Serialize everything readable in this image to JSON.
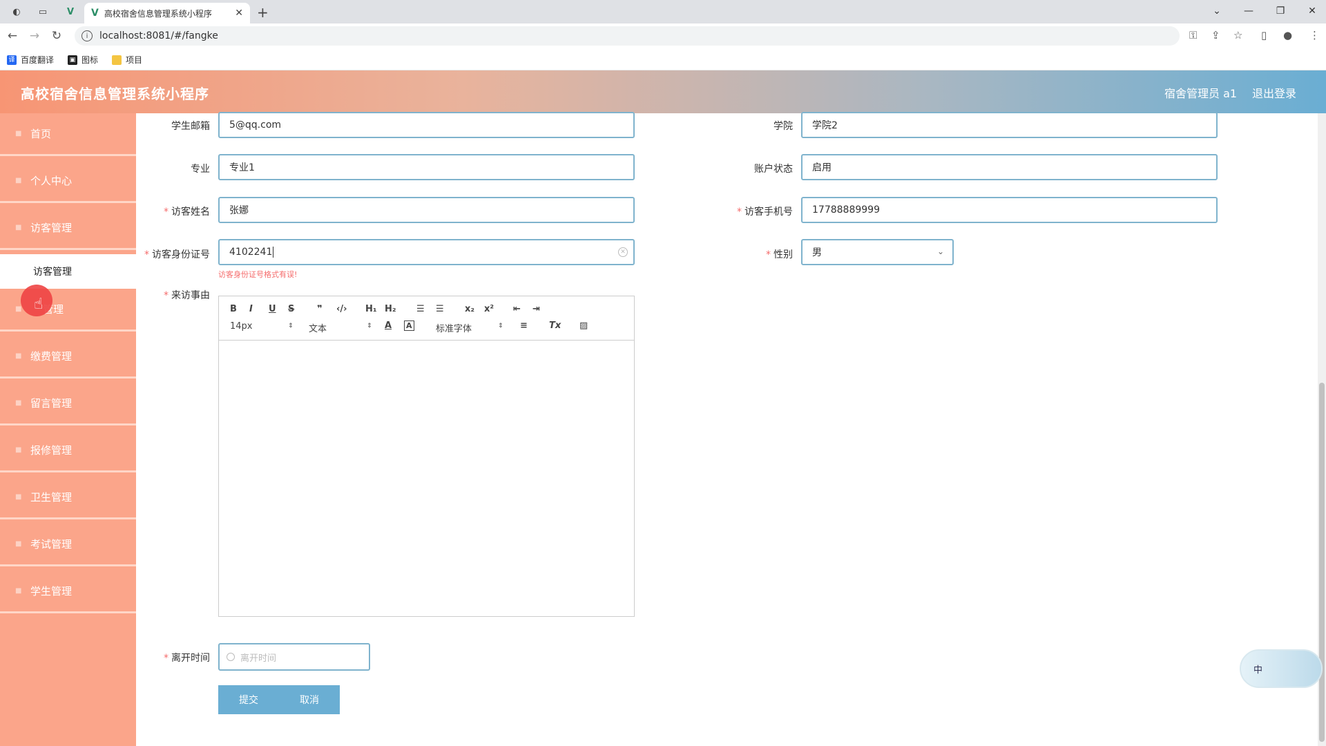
{
  "browser": {
    "tab_title": "高校宿舍信息管理系统小程序",
    "url": "localhost:8081/#/fangke",
    "bookmarks": [
      "百度翻译",
      "图标",
      "项目"
    ]
  },
  "header": {
    "app_title": "高校宿舍信息管理系统小程序",
    "user": "宿舍管理员 a1",
    "logout": "退出登录"
  },
  "sidebar": {
    "items": [
      {
        "label": "首页"
      },
      {
        "label": "个人中心"
      },
      {
        "label": "访客管理"
      },
      {
        "label": "访客管理",
        "sub": true
      },
      {
        "label": "管理"
      },
      {
        "label": "缴费管理"
      },
      {
        "label": "留言管理"
      },
      {
        "label": "报修管理"
      },
      {
        "label": "卫生管理"
      },
      {
        "label": "考试管理"
      },
      {
        "label": "学生管理"
      }
    ]
  },
  "form": {
    "student_email": {
      "label": "学生邮箱",
      "value": "5@qq.com"
    },
    "college": {
      "label": "学院",
      "value": "学院2"
    },
    "major": {
      "label": "专业",
      "value": "专业1"
    },
    "account_status": {
      "label": "账户状态",
      "value": "启用"
    },
    "visitor_name": {
      "label": "访客姓名",
      "value": "张娜"
    },
    "visitor_phone": {
      "label": "访客手机号",
      "value": "17788889999"
    },
    "visitor_id": {
      "label": "访客身份证号",
      "value": "4102241",
      "error": "访客身份证号格式有误!"
    },
    "gender": {
      "label": "性别",
      "value": "男"
    },
    "reason": {
      "label": "来访事由"
    },
    "leave_time": {
      "label": "离开时间",
      "placeholder": "离开时间"
    },
    "submit": "提交",
    "cancel": "取消"
  },
  "editor": {
    "font_size": "14px",
    "paragraph": "文本",
    "font_family": "标准字体"
  },
  "ime": {
    "label": "中"
  }
}
